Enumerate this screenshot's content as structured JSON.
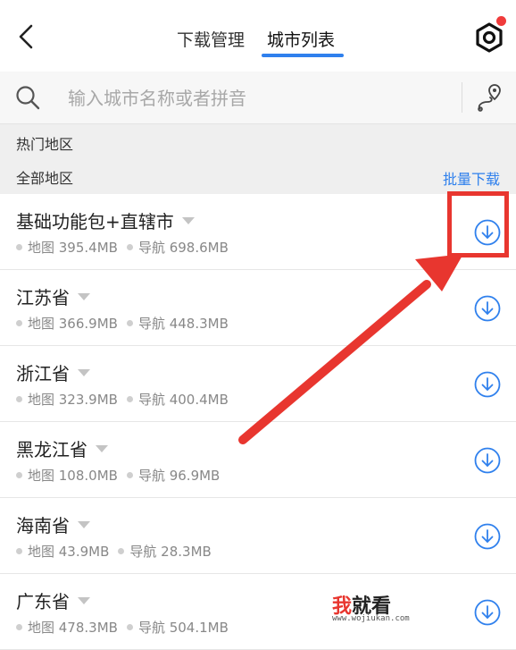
{
  "header": {
    "tabs": [
      {
        "label": "下载管理",
        "active": false
      },
      {
        "label": "城市列表",
        "active": true
      }
    ],
    "back_icon": "chevron-left-icon",
    "settings_icon": "hexagon-gear-icon",
    "notification_dot_color": "#f03b3b",
    "accent_color": "#2f80ed"
  },
  "search": {
    "placeholder": "输入城市名称或者拼音",
    "value": "",
    "search_icon": "search-icon",
    "location_icon": "map-pin-route-icon"
  },
  "sections": {
    "hot": "热门地区",
    "all": "全部地区",
    "batch_download": "批量下载"
  },
  "cities": [
    {
      "name": "基础功能包+直辖市",
      "map": "地图 395.4MB",
      "nav": "导航 698.6MB"
    },
    {
      "name": "江苏省",
      "map": "地图 366.9MB",
      "nav": "导航 448.3MB"
    },
    {
      "name": "浙江省",
      "map": "地图 323.9MB",
      "nav": "导航 400.4MB"
    },
    {
      "name": "黑龙江省",
      "map": "地图 108.0MB",
      "nav": "导航 96.9MB"
    },
    {
      "name": "海南省",
      "map": "地图 43.9MB",
      "nav": "导航 28.3MB"
    },
    {
      "name": "广东省",
      "map": "地图 478.3MB",
      "nav": "导航 504.1MB"
    }
  ],
  "annotation_color": "#e8362f",
  "watermark": {
    "text_wo": "我",
    "text_rest": "就看",
    "url": "www.wojiukan.com"
  }
}
